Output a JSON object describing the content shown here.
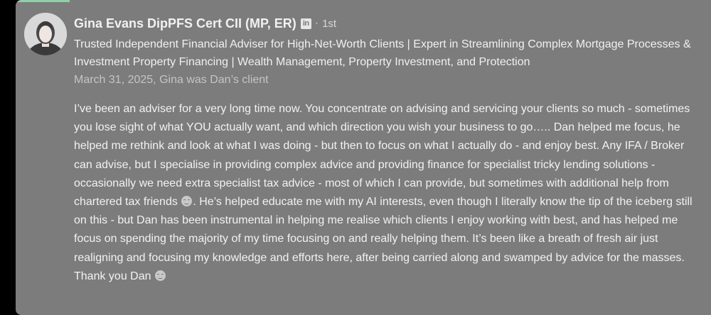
{
  "recommendation": {
    "author_name": "Gina Evans DipPFS Cert CII (MP, ER)",
    "linkedin_badge": "in",
    "separator": "·",
    "connection_degree": "1st",
    "headline": "Trusted Independent Financial Adviser for High-Net-Worth Clients | Expert in Streamlining Complex Mortgage Processes & Investment Property Financing | Wealth Management, Property Investment, and Protection",
    "meta": "March 31, 2025, Gina was Dan’s client",
    "body_part1": "I’ve been an adviser for a very long time now. You concentrate on advising and servicing your clients so much - sometimes you lose sight of what YOU actually want, and which direction you wish your business to go….. Dan helped me focus, he helped me rethink and look at what I was doing - but then to focus on what I actually do - and enjoy best. Any IFA / Broker can advise, but I specialise in providing complex advice and providing finance for specialist tricky lending solutions - occasionally we need extra specialist tax advice - most of which I can provide, but sometimes with additional help from chartered tax friends",
    "body_part2": ". He’s helped educate me with my AI interests, even though I literally know the tip of the iceberg still on this - but Dan has been instrumental in helping me realise which clients I enjoy working with best, and has helped me focus on spending the majority of my time focusing on and really helping them. It’s been like a breath of fresh air just realigning and focusing my knowledge and efforts here, after being carried along and swamped by advice for the masses. Thank you Dan",
    "emoji_icon": "smiling-face-icon"
  },
  "colors": {
    "card_background": "#7c7c7c",
    "accent_bar": "#8fd0a8",
    "text_primary": "#f1f1f1",
    "text_secondary": "#c4c4c4"
  }
}
